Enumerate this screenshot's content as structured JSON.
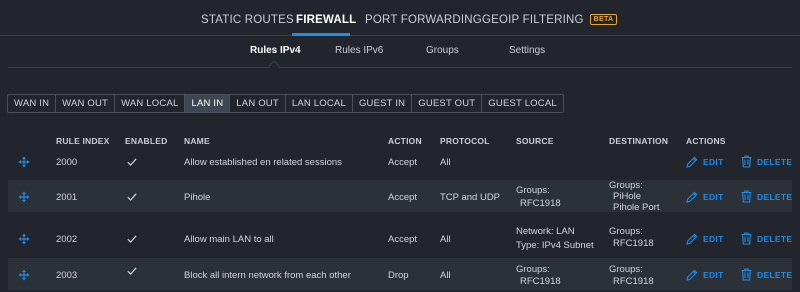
{
  "topnav": {
    "tabs": [
      {
        "label": "STATIC ROUTES"
      },
      {
        "label": "FIREWALL"
      },
      {
        "label": "PORT FORWARDING"
      },
      {
        "label": "GEOIP FILTERING",
        "badge": "BETA"
      }
    ]
  },
  "subnav": {
    "tabs": [
      {
        "label": "Rules IPv4"
      },
      {
        "label": "Rules IPv6"
      },
      {
        "label": "Groups"
      },
      {
        "label": "Settings"
      }
    ]
  },
  "rule_sets": [
    "WAN IN",
    "WAN OUT",
    "WAN LOCAL",
    "LAN IN",
    "LAN OUT",
    "LAN LOCAL",
    "GUEST IN",
    "GUEST OUT",
    "GUEST LOCAL"
  ],
  "selected_rule_set": "LAN IN",
  "table": {
    "headers": {
      "rule_index": "RULE INDEX",
      "enabled": "ENABLED",
      "name": "NAME",
      "action": "ACTION",
      "protocol": "PROTOCOL",
      "source": "SOURCE",
      "destination": "DESTINATION",
      "actions": "ACTIONS"
    },
    "edit_label": "EDIT",
    "delete_label": "DELETE",
    "rows": [
      {
        "index": "2000",
        "enabled": true,
        "name": "Allow established en related sessions",
        "action": "Accept",
        "protocol": "All",
        "source": {
          "l1": "",
          "l2": ""
        },
        "destination": {
          "l1": "",
          "l2": "",
          "l3": ""
        }
      },
      {
        "index": "2001",
        "enabled": true,
        "name": "Pihole",
        "action": "Accept",
        "protocol": "TCP and UDP",
        "source": {
          "l1": "Groups:",
          "l2": "RFC1918"
        },
        "destination": {
          "l1": "Groups:",
          "l2": "PiHole",
          "l3": "Pihole Port"
        }
      },
      {
        "index": "2002",
        "enabled": true,
        "name": "Allow main LAN to all",
        "action": "Accept",
        "protocol": "All",
        "source": {
          "l1": "Network: LAN",
          "l2": "Type: IPv4 Subnet"
        },
        "destination": {
          "l1": "Groups:",
          "l2": "RFC1918",
          "l3": ""
        }
      },
      {
        "index": "2003",
        "enabled": true,
        "name": "Block all intern network from each other",
        "action": "Drop",
        "protocol": "All",
        "source": {
          "l1": "Groups:",
          "l2": "RFC1918"
        },
        "destination": {
          "l1": "Groups:",
          "l2": "RFC1918",
          "l3": ""
        }
      }
    ]
  },
  "colors": {
    "accent": "#1f8ce6",
    "beta": "#e7a33c",
    "background": "#22262c",
    "row_alt": "#2c3037"
  }
}
